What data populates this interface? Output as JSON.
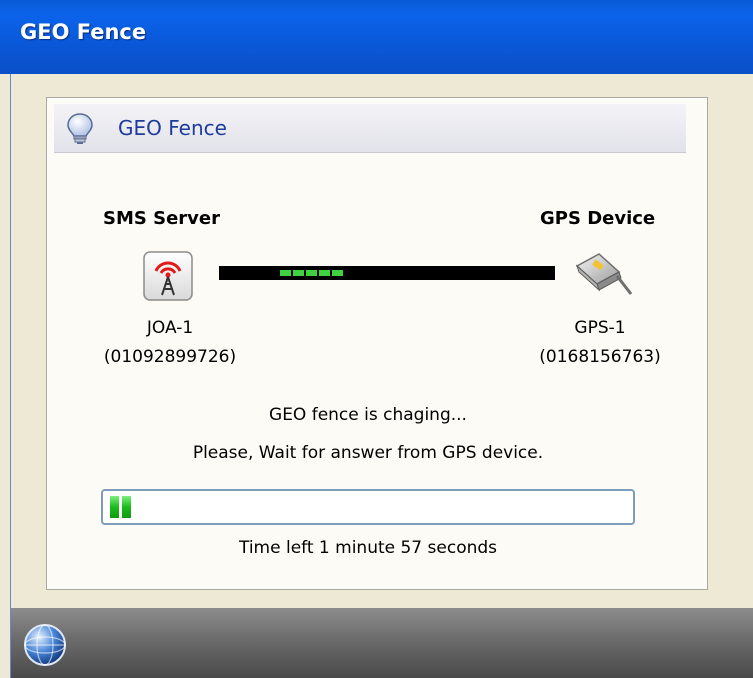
{
  "window": {
    "title": "GEO Fence"
  },
  "header": {
    "title": "GEO Fence",
    "icon": "lightbulb-icon"
  },
  "server": {
    "label": "SMS Server",
    "name": "JOA-1",
    "number": "(01092899726)",
    "icon": "antenna-tower-icon"
  },
  "device": {
    "label": "GPS Device",
    "name": "GPS-1",
    "number": "(0168156763)",
    "icon": "gps-device-icon"
  },
  "status": {
    "line1": "GEO fence is chaging...",
    "line2": "Please, Wait for answer from GPS device."
  },
  "progress": {
    "value": 0.04
  },
  "timer": {
    "text": "Time left 1 minute 57 seconds"
  },
  "statusbar": {
    "icon": "globe-icon"
  },
  "colors": {
    "titlebar": "#0a5ad6",
    "header_text": "#1d3c9c",
    "progress_fill": "#1cbb1c",
    "link_active": "#3fd23f"
  }
}
